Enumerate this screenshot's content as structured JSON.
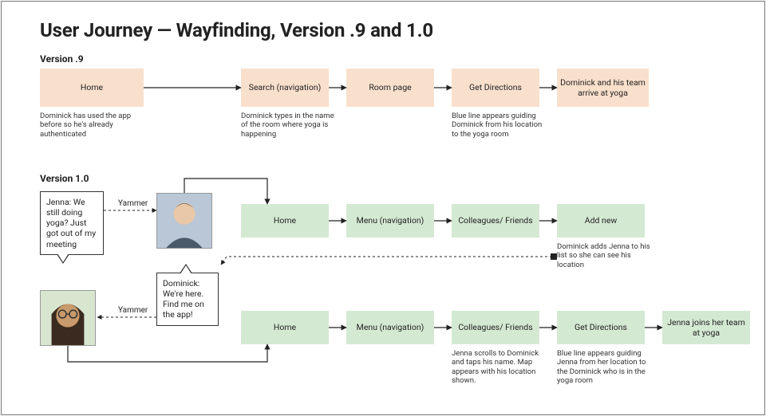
{
  "title": "User Journey — Wayfinding, Version .9 and 1.0",
  "headings": {
    "v9": "Version .9",
    "v10": "Version 1.0"
  },
  "colors": {
    "v9_fill": "#f9e0cc",
    "v10_fill": "#d4e9d2"
  },
  "v9": {
    "steps": {
      "home": {
        "label": "Home",
        "caption": "Dominick has used the app before so he's already authenticated"
      },
      "search": {
        "label": "Search (navigation)",
        "caption": "Dominick types in the name of the room where yoga is happening"
      },
      "room": {
        "label": "Room page"
      },
      "directions": {
        "label": "Get Directions",
        "caption": "Blue line appears guiding Dominick from his location to the yoga room"
      },
      "arrive": {
        "label": "Dominick and his team arrive at yoga"
      }
    }
  },
  "v10": {
    "rowA": {
      "home": {
        "label": "Home"
      },
      "menu": {
        "label": "Menu (navigation)"
      },
      "colleagues": {
        "label": "Colleagues/ Friends"
      },
      "addnew": {
        "label": "Add new",
        "caption": "Dominick adds Jenna to his list so she can see his location"
      }
    },
    "rowB": {
      "home": {
        "label": "Home"
      },
      "menu": {
        "label": "Menu (navigation)"
      },
      "colleagues": {
        "label": "Colleagues/ Friends",
        "caption": "Jenna scrolls to Dominick and taps his name. Map appears with his location shown."
      },
      "directions": {
        "label": "Get Directions",
        "caption": "Blue line appears guiding Jenna from her location to the Dominick who is in the yoga room"
      },
      "arrive": {
        "label": "Jenna joins her team at yoga"
      }
    },
    "speech": {
      "jenna": "Jenna: We still doing yoga? Just got out of my meeting",
      "dominick": "Dominick: We're here. Find me on the app!"
    },
    "channel": "Yammer",
    "people": {
      "dominick": "dominick-photo",
      "jenna": "jenna-photo"
    }
  }
}
